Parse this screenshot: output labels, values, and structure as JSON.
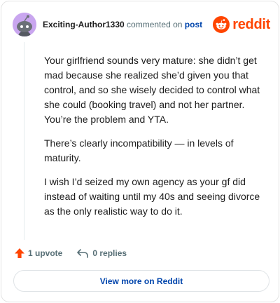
{
  "comment": {
    "username": "Exciting-Author1330",
    "action_text": "commented on",
    "post_link": "post",
    "paragraphs": [
      "Your girlfriend sounds very mature: she didn’t get mad because she realized she’d given you that control, and so she wisely decided to control what she could (booking travel) and not her partner. You’re the problem and YTA.",
      "There’s clearly incompatibility — in levels of maturity.",
      "I wish I’d seized my own agency as your gf did instead of waiting until my 40s and seeing divorce as the only realistic way to do it."
    ]
  },
  "brand": {
    "wordmark": "reddit",
    "color": "#ff4500",
    "icon": "reddit-logo-icon"
  },
  "actions": {
    "upvote_label": "1 upvote",
    "upvote_icon": "upvote-arrow-icon",
    "upvote_color": "#ff4500",
    "replies_label": "0 replies",
    "replies_icon": "reply-arrow-icon"
  },
  "footer": {
    "view_more_label": "View more on Reddit"
  },
  "colors": {
    "avatar_bg": "#c9a6ef",
    "link": "#0045ac",
    "muted": "#576f76"
  }
}
